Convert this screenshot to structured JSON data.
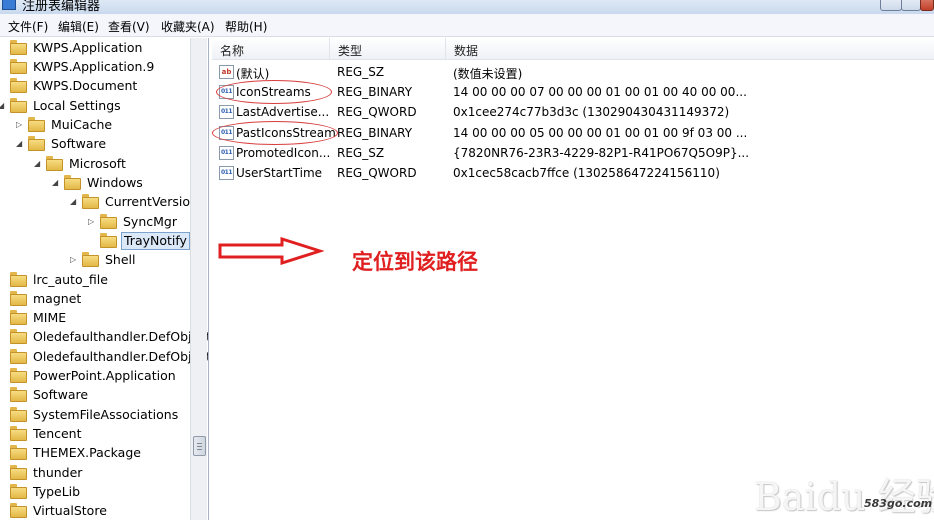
{
  "window": {
    "title": "注册表编辑器"
  },
  "menu": [
    "文件(F)",
    "编辑(E)",
    "查看(V)",
    "收藏夹(A)",
    "帮助(H)"
  ],
  "tree": [
    {
      "label": "KWPS.Application",
      "expander": ""
    },
    {
      "label": "KWPS.Application.9",
      "expander": ""
    },
    {
      "label": "KWPS.Document",
      "expander": ""
    },
    {
      "label": "Local Settings",
      "expander": "◢"
    },
    {
      "label": "MuiCache",
      "expander": "▷"
    },
    {
      "label": "Software",
      "expander": "◢"
    },
    {
      "label": "Microsoft",
      "expander": "◢"
    },
    {
      "label": "Windows",
      "expander": "◢"
    },
    {
      "label": "CurrentVersion",
      "expander": "◢"
    },
    {
      "label": "SyncMgr",
      "expander": "▷"
    },
    {
      "label": "TrayNotify",
      "expander": "",
      "selected": true
    },
    {
      "label": "Shell",
      "expander": "▷"
    },
    {
      "label": "lrc_auto_file",
      "expander": ""
    },
    {
      "label": "magnet",
      "expander": ""
    },
    {
      "label": "MIME",
      "expander": ""
    },
    {
      "label": "Oledefaulthandler.DefObject",
      "expander": ""
    },
    {
      "label": "Oledefaulthandler.DefObject",
      "expander": ""
    },
    {
      "label": "PowerPoint.Application",
      "expander": ""
    },
    {
      "label": "Software",
      "expander": ""
    },
    {
      "label": "SystemFileAssociations",
      "expander": ""
    },
    {
      "label": "Tencent",
      "expander": ""
    },
    {
      "label": "THEMEX.Package",
      "expander": ""
    },
    {
      "label": "thunder",
      "expander": ""
    },
    {
      "label": "TypeLib",
      "expander": ""
    },
    {
      "label": "VirtualStore",
      "expander": ""
    }
  ],
  "columns": {
    "name": "名称",
    "type": "类型",
    "data": "数据"
  },
  "values": [
    {
      "icon": "string-value-icon",
      "icon_text": "ab",
      "name": "(默认)",
      "type": "REG_SZ",
      "data": "(数值未设置)"
    },
    {
      "icon": "binary-value-icon",
      "icon_text": "011",
      "name": "IconStreams",
      "type": "REG_BINARY",
      "data": "14 00 00 00 07 00 00 00 01 00 01 00 40 00 00..."
    },
    {
      "icon": "binary-value-icon",
      "icon_text": "011",
      "name": "LastAdvertise...",
      "type": "REG_QWORD",
      "data": "0x1cee274c77b3d3c (130290430431149372)"
    },
    {
      "icon": "binary-value-icon",
      "icon_text": "011",
      "name": "PastIconsStream",
      "type": "REG_BINARY",
      "data": "14 00 00 00 05 00 00 00 01 00 01 00 9f 03 00 ..."
    },
    {
      "icon": "binary-value-icon",
      "icon_text": "011",
      "name": "PromotedIcon...",
      "type": "REG_SZ",
      "data": "{7820NR76-23R3-4229-82P1-R41PO67Q5O9P}..."
    },
    {
      "icon": "binary-value-icon",
      "icon_text": "011",
      "name": "UserStartTime",
      "type": "REG_QWORD",
      "data": "0x1cec58cacb7ffce (130258647224156110)"
    }
  ],
  "annotation": "定位到该路径",
  "watermark": {
    "text": "Baidu 经验",
    "site": "583go.com"
  },
  "colors": {
    "annotation": "#e02020",
    "highlight": "#d83c3c",
    "selection": "#dbe8f7",
    "folder": "#e3b847"
  }
}
